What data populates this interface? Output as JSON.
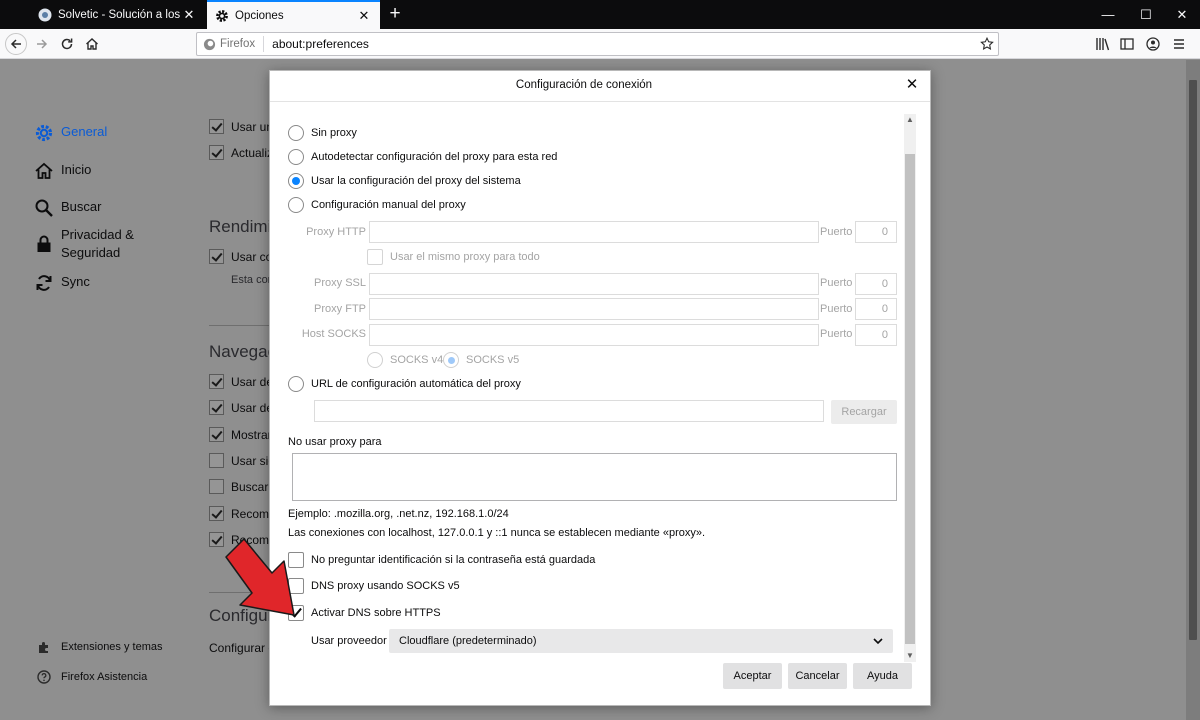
{
  "tabs": [
    {
      "label": "Solvetic - Solución a los proble",
      "active": false
    },
    {
      "label": "Opciones",
      "active": true
    }
  ],
  "window_controls": {
    "minimize": "—",
    "maximize": "☐",
    "close": "✕"
  },
  "urlbar": {
    "identity": "Firefox",
    "url": "about:preferences"
  },
  "sidebar": {
    "categories": [
      {
        "label": "General",
        "selected": true
      },
      {
        "label": "Inicio"
      },
      {
        "label": "Buscar"
      },
      {
        "label": "Privacidad &",
        "label2": "Seguridad"
      },
      {
        "label": "Sync"
      }
    ],
    "footer": [
      {
        "label": "Extensiones y temas"
      },
      {
        "label": "Firefox Asistencia"
      }
    ]
  },
  "background": {
    "checks_top": [
      {
        "label": "Usar un",
        "checked": true
      },
      {
        "label": "Actualiz",
        "checked": true
      }
    ],
    "rendimiento": {
      "title": "Rendimie",
      "check": "Usar co",
      "sub": "Esta con"
    },
    "navegacion": {
      "title": "Navegac",
      "checks": [
        {
          "label": "Usar de",
          "checked": true
        },
        {
          "label": "Usar de",
          "checked": true
        },
        {
          "label": "Mostrar",
          "checked": true
        },
        {
          "label": "Usar sie",
          "checked": false
        },
        {
          "label": "Buscar t",
          "checked": false
        },
        {
          "label": "Recome",
          "checked": true
        },
        {
          "label": "Recome",
          "checked": true
        }
      ]
    },
    "configuracion": {
      "title": "Configur",
      "text": "Configurar c"
    }
  },
  "dialog": {
    "title": "Configuración de conexión",
    "proxy_options": {
      "no_proxy": "Sin proxy",
      "autodetect": "Autodetectar configuración del proxy para esta red",
      "system": "Usar la configuración del proxy del sistema",
      "manual": "Configuración manual del proxy",
      "auto_url": "URL de configuración automática del proxy",
      "selected": "system"
    },
    "manual": {
      "http_label": "Proxy HTTP",
      "same_proxy": "Usar el mismo proxy para todo",
      "ssl_label": "Proxy SSL",
      "ftp_label": "Proxy FTP",
      "socks_label": "Host SOCKS",
      "port_label": "Puerto",
      "http_port": "0",
      "ssl_port": "0",
      "ftp_port": "0",
      "socks_port": "0",
      "socks_v4": "SOCKS v4",
      "socks_v5": "SOCKS v5"
    },
    "reload_button": "Recargar",
    "no_proxy_for": "No usar proxy para",
    "example": "Ejemplo: .mozilla.org, .net.nz, 192.168.1.0/24",
    "localhost_note": "Las conexiones con localhost, 127.0.0.1 y ::1 nunca se establecen mediante «proxy».",
    "checks": {
      "no_auth": {
        "label": "No preguntar identificación si la contraseña está guardada",
        "checked": false
      },
      "dns_socks": {
        "label": "DNS proxy usando SOCKS v5",
        "checked": false
      },
      "doh": {
        "label": "Activar DNS sobre HTTPS",
        "checked": true
      }
    },
    "provider_label": "Usar proveedor",
    "provider_value": "Cloudflare (predeterminado)",
    "buttons": {
      "accept": "Aceptar",
      "cancel": "Cancelar",
      "help": "Ayuda"
    }
  },
  "colors": {
    "accent": "#0a84ff",
    "arrow": "#e0262a"
  }
}
